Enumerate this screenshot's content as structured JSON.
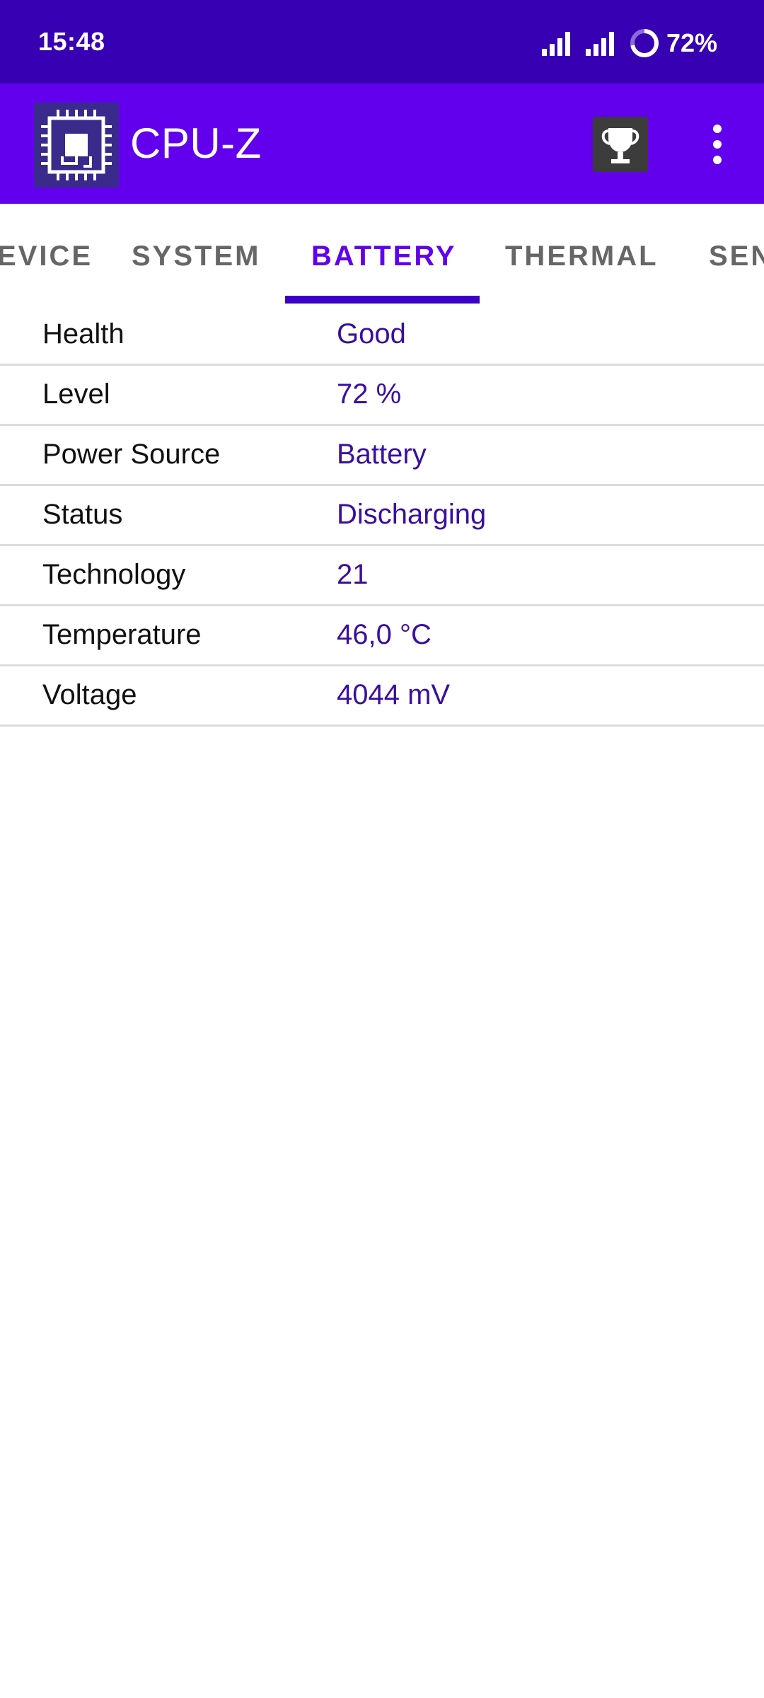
{
  "status_bar": {
    "time": "15:48",
    "battery_percent": "72%",
    "icons": [
      "signal-icon",
      "signal-icon",
      "battery-ring-icon"
    ]
  },
  "app_bar": {
    "title": "CPU-Z",
    "logo_icon": "cpu-chip-icon",
    "actions": [
      "trophy-icon",
      "more-vert-icon"
    ]
  },
  "tabs": [
    {
      "label": "EVICE",
      "active": false
    },
    {
      "label": "SYSTEM",
      "active": false
    },
    {
      "label": "BATTERY",
      "active": true
    },
    {
      "label": "THERMAL",
      "active": false
    },
    {
      "label": "SEN",
      "active": false
    }
  ],
  "battery": [
    {
      "label": "Health",
      "value": "Good"
    },
    {
      "label": "Level",
      "value": "72 %"
    },
    {
      "label": "Power Source",
      "value": "Battery"
    },
    {
      "label": "Status",
      "value": "Discharging"
    },
    {
      "label": "Technology",
      "value": "21"
    },
    {
      "label": "Temperature",
      "value": "46,0 °C"
    },
    {
      "label": "Voltage",
      "value": "4044 mV"
    }
  ],
  "colors": {
    "status_bar": "#3700b3",
    "app_bar": "#6200ee",
    "accent": "#6200ee",
    "value_text": "#3a0fa0"
  }
}
